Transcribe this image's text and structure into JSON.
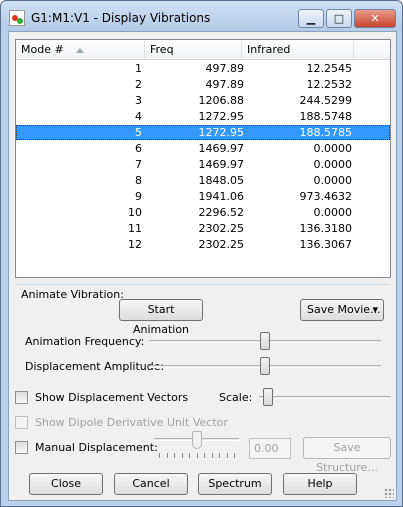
{
  "window": {
    "title": "G1:M1:V1 - Display Vibrations",
    "minimize_glyph": "▁",
    "maximize_glyph": "□",
    "close_glyph": "✕",
    "app_icon": "gaussview-app-icon"
  },
  "table": {
    "columns": [
      "Mode #",
      "Freq",
      "Infrared"
    ],
    "sorted_column": "Mode #",
    "selected_mode": "5",
    "rows": [
      {
        "mode": "1",
        "freq": "497.89",
        "ir": "12.2545"
      },
      {
        "mode": "2",
        "freq": "497.89",
        "ir": "12.2532"
      },
      {
        "mode": "3",
        "freq": "1206.88",
        "ir": "244.5299"
      },
      {
        "mode": "4",
        "freq": "1272.95",
        "ir": "188.5748"
      },
      {
        "mode": "5",
        "freq": "1272.95",
        "ir": "188.5785"
      },
      {
        "mode": "6",
        "freq": "1469.97",
        "ir": "0.0000"
      },
      {
        "mode": "7",
        "freq": "1469.97",
        "ir": "0.0000"
      },
      {
        "mode": "8",
        "freq": "1848.05",
        "ir": "0.0000"
      },
      {
        "mode": "9",
        "freq": "1941.06",
        "ir": "973.4632"
      },
      {
        "mode": "10",
        "freq": "2296.52",
        "ir": "0.0000"
      },
      {
        "mode": "11",
        "freq": "2302.25",
        "ir": "136.3180"
      },
      {
        "mode": "12",
        "freq": "2302.25",
        "ir": "136.3067"
      }
    ]
  },
  "animate": {
    "group_label": "Animate Vibration:",
    "start_button": "Start Animation",
    "save_movie_button": "Save Movie...",
    "save_movie_arrow": "▾",
    "frequency_label": "Animation Frequency:",
    "frequency_level": 0.5,
    "amplitude_label": "Displacement Amplitude:",
    "amplitude_level": 0.5
  },
  "options": {
    "show_vectors_label": "Show Displacement Vectors",
    "show_vectors_checked": false,
    "scale_label": "Scale:",
    "scale_level": 0.0,
    "dipole_label": "Show Dipole Derivative Unit Vector",
    "dipole_checked": false,
    "manual_label": "Manual Displacement:",
    "manual_checked": false,
    "manual_level": 0.5,
    "manual_value": "0.00",
    "save_structure_button": "Save Structure..."
  },
  "buttons": {
    "close": "Close",
    "cancel": "Cancel",
    "spectrum": "Spectrum",
    "help": "Help"
  }
}
